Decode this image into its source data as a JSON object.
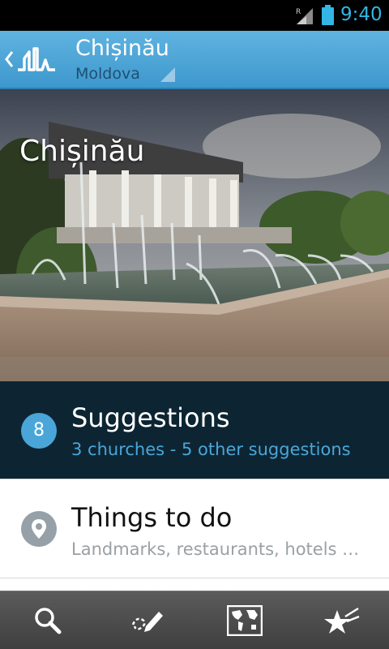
{
  "status_bar": {
    "time": "9:40",
    "network_label": "R"
  },
  "action_bar": {
    "title": "Chișinău",
    "subtitle": "Moldova"
  },
  "hero": {
    "title": "Chișinău"
  },
  "suggestions": {
    "badge_count": "8",
    "label": "Suggestions",
    "detail": "3 churches - 5 other suggestions"
  },
  "things_to_do": {
    "label": "Things to do",
    "detail": "Landmarks, restaurants, hotels …"
  },
  "bottom_bar": {
    "tabs": [
      "search-icon",
      "journal-pencil-icon",
      "world-map-icon",
      "favorites-star-icon"
    ]
  },
  "colors": {
    "accent": "#33b5e5",
    "action_bar": "#4aa6d8",
    "dark_row": "#0d2533",
    "badge_blue": "#4aa6d8",
    "badge_gray": "#95a0a8"
  }
}
